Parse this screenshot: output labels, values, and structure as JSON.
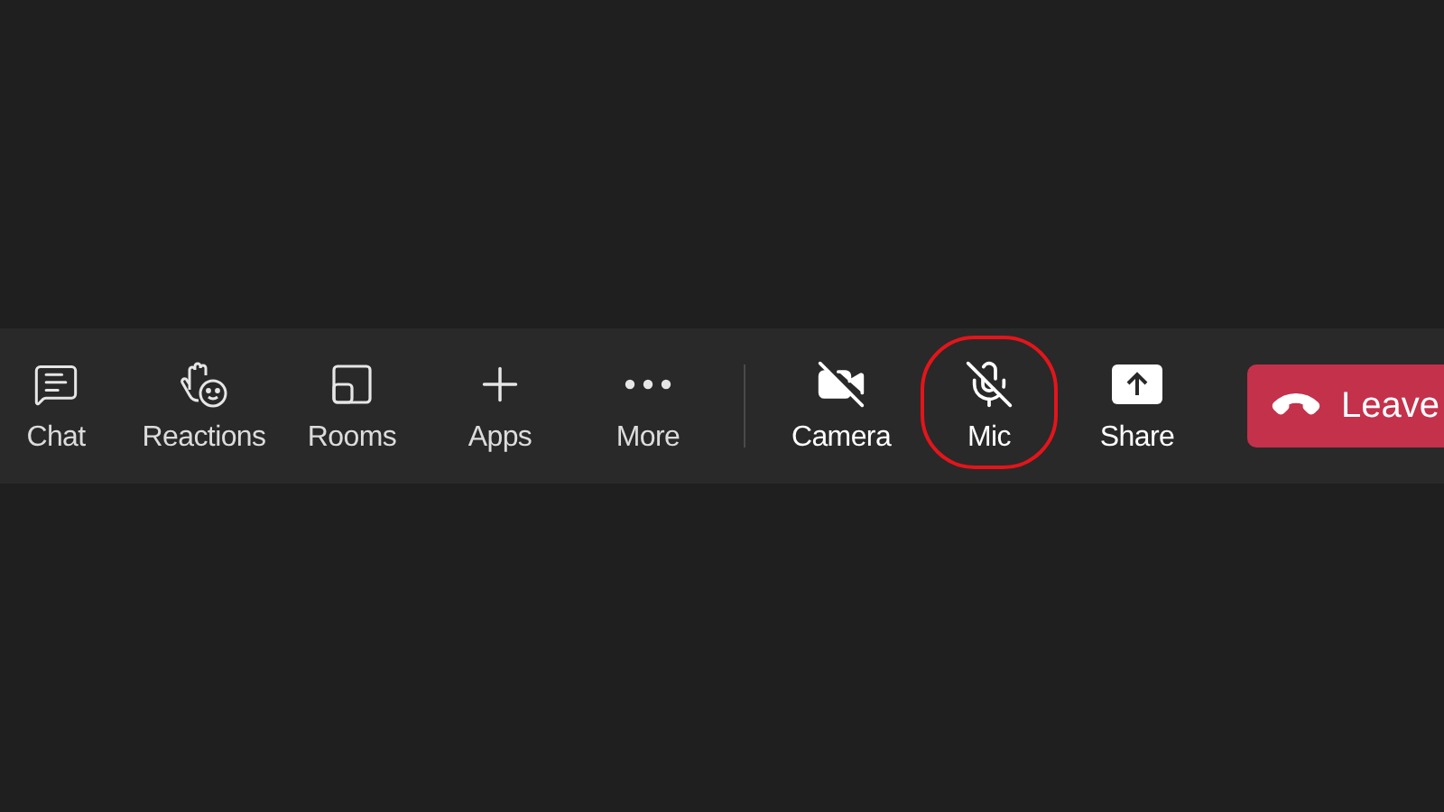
{
  "toolbar": {
    "items": [
      {
        "label": "Chat",
        "off": false,
        "highlighted": false
      },
      {
        "label": "Reactions",
        "off": false,
        "highlighted": false
      },
      {
        "label": "Rooms",
        "off": false,
        "highlighted": false
      },
      {
        "label": "Apps",
        "off": false,
        "highlighted": false
      },
      {
        "label": "More",
        "off": false,
        "highlighted": false
      }
    ],
    "device_items": [
      {
        "label": "Camera",
        "off": true,
        "highlighted": false
      },
      {
        "label": "Mic",
        "off": true,
        "highlighted": true
      },
      {
        "label": "Share",
        "off": false,
        "highlighted": false
      }
    ],
    "leave_button": {
      "label": "Leave"
    }
  }
}
